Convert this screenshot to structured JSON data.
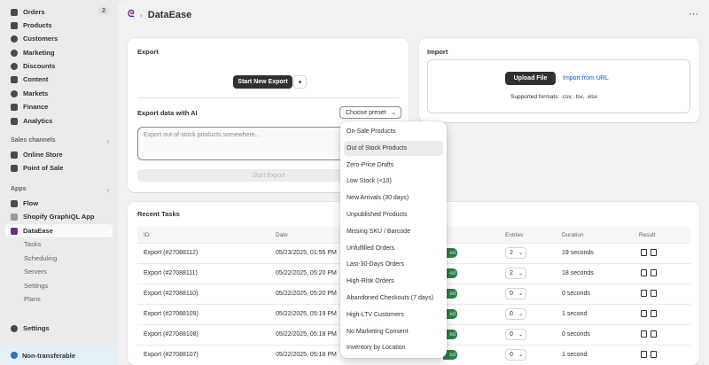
{
  "sidebar": {
    "items": [
      {
        "label": "Orders",
        "badge": "2"
      },
      {
        "label": "Products"
      },
      {
        "label": "Customers"
      },
      {
        "label": "Marketing"
      },
      {
        "label": "Discounts"
      },
      {
        "label": "Content"
      },
      {
        "label": "Markets"
      },
      {
        "label": "Finance"
      },
      {
        "label": "Analytics"
      }
    ],
    "sales_channels_label": "Sales channels",
    "channels": [
      {
        "label": "Online Store"
      },
      {
        "label": "Point of Sale"
      }
    ],
    "apps_label": "Apps",
    "apps": [
      {
        "label": "Flow"
      },
      {
        "label": "Shopify GraphiQL App"
      },
      {
        "label": "DataEase"
      }
    ],
    "app_subitems": [
      {
        "label": "Tasks"
      },
      {
        "label": "Scheduling"
      },
      {
        "label": "Servers"
      },
      {
        "label": "Settings"
      },
      {
        "label": "Plans"
      }
    ],
    "settings_label": "Settings",
    "footer_label": "Non-transferable"
  },
  "header": {
    "title": "DataEase",
    "more": "···"
  },
  "export_card": {
    "title": "Export",
    "start_button": "Start New Export",
    "ai_title": "Export data with AI",
    "preset_label": "Choose preset",
    "textarea_placeholder": "Export out-of-stock products somewhere...",
    "start_export_label": "Start Export"
  },
  "import_card": {
    "title": "Import",
    "upload_label": "Upload File",
    "url_label": "Import from URL",
    "formats": "Supported formats: .csv, .tsv, .xlsx"
  },
  "tasks": {
    "title": "Recent Tasks",
    "columns": {
      "id": "ID",
      "date": "Date",
      "entries": "Entries",
      "duration": "Duration",
      "result": "Result"
    },
    "rows": [
      {
        "id": "Export (#27088112)",
        "date": "05/23/2025, 01:55 PM",
        "status": "ed",
        "entries": "2",
        "duration": "19 seconds"
      },
      {
        "id": "Export (#27088111)",
        "date": "05/22/2025, 05:20 PM",
        "status": "ed",
        "entries": "2",
        "duration": "18 seconds"
      },
      {
        "id": "Export (#27088110)",
        "date": "05/22/2025, 05:20 PM",
        "status": "ed",
        "entries": "0",
        "duration": "0 seconds"
      },
      {
        "id": "Export (#27088109)",
        "date": "05/22/2025, 05:19 PM",
        "status": "ed",
        "entries": "0",
        "duration": "1 second"
      },
      {
        "id": "Export (#27088108)",
        "date": "05/22/2025, 05:18 PM",
        "status": "ed",
        "entries": "0",
        "duration": "0 seconds"
      },
      {
        "id": "Export (#27088107)",
        "date": "05/22/2025, 05:18 PM",
        "status": "ed",
        "entries": "0",
        "duration": "1 second"
      }
    ]
  },
  "preset_menu": {
    "options": [
      "On-Sale Products",
      "Out of Stock Products",
      "Zero-Price Drafts",
      "Low Stock (<10)",
      "New Arrivals (30 days)",
      "Unpublished Products",
      "Missing SKU / Barcode",
      "Unfulfilled Orders",
      "Last-30-Days Orders",
      "High-Risk Orders",
      "Abandoned Checkouts (7 days)",
      "High-LTV Customers",
      "No Marketing Consent",
      "Inventory by Location"
    ],
    "hovered_index": 1
  },
  "colors": {
    "accent": "#005bd3",
    "dark_button": "#303030",
    "status_green": "#2e7d4a",
    "logo": "#6b2a8b"
  }
}
